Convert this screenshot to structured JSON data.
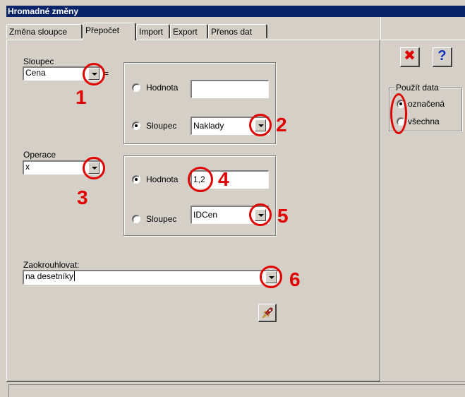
{
  "window": {
    "title": "Hromadné změny"
  },
  "tabs": [
    {
      "label": "Změna sloupce"
    },
    {
      "label": "Přepočet"
    },
    {
      "label": "Import"
    },
    {
      "label": "Export"
    },
    {
      "label": "Přenos dat"
    }
  ],
  "active_tab": "Přepočet",
  "form": {
    "sloupec_label": "Sloupec",
    "sloupec_value": "Cena",
    "equals": "=",
    "group1": {
      "hodnota_label": "Hodnota",
      "hodnota_value": "",
      "sloupec_label": "Sloupec",
      "sloupec_value": "Naklady",
      "selected": "Sloupec"
    },
    "operace_label": "Operace",
    "operace_value": "x",
    "group2": {
      "hodnota_label": "Hodnota",
      "hodnota_value": "1,2",
      "sloupec_label": "Sloupec",
      "sloupec_value": "IDCen",
      "selected": "Hodnota"
    },
    "zaokrouhlovat_label": "Zaokrouhlovat:",
    "zaokrouhlovat_value": "na desetníky"
  },
  "right_pane": {
    "use_data_legend": "Použít data",
    "option_marked": "označená",
    "option_all": "všechna",
    "selected": "označená"
  },
  "annotations": [
    "1",
    "2",
    "3",
    "4",
    "5",
    "6"
  ],
  "colors": {
    "titlebar": "#0a246a",
    "annotation": "#e00000",
    "face": "#d4d0c8"
  },
  "icons": {
    "close": "red-x-icon",
    "help": "question-mark-icon",
    "execute": "rocket-icon"
  }
}
